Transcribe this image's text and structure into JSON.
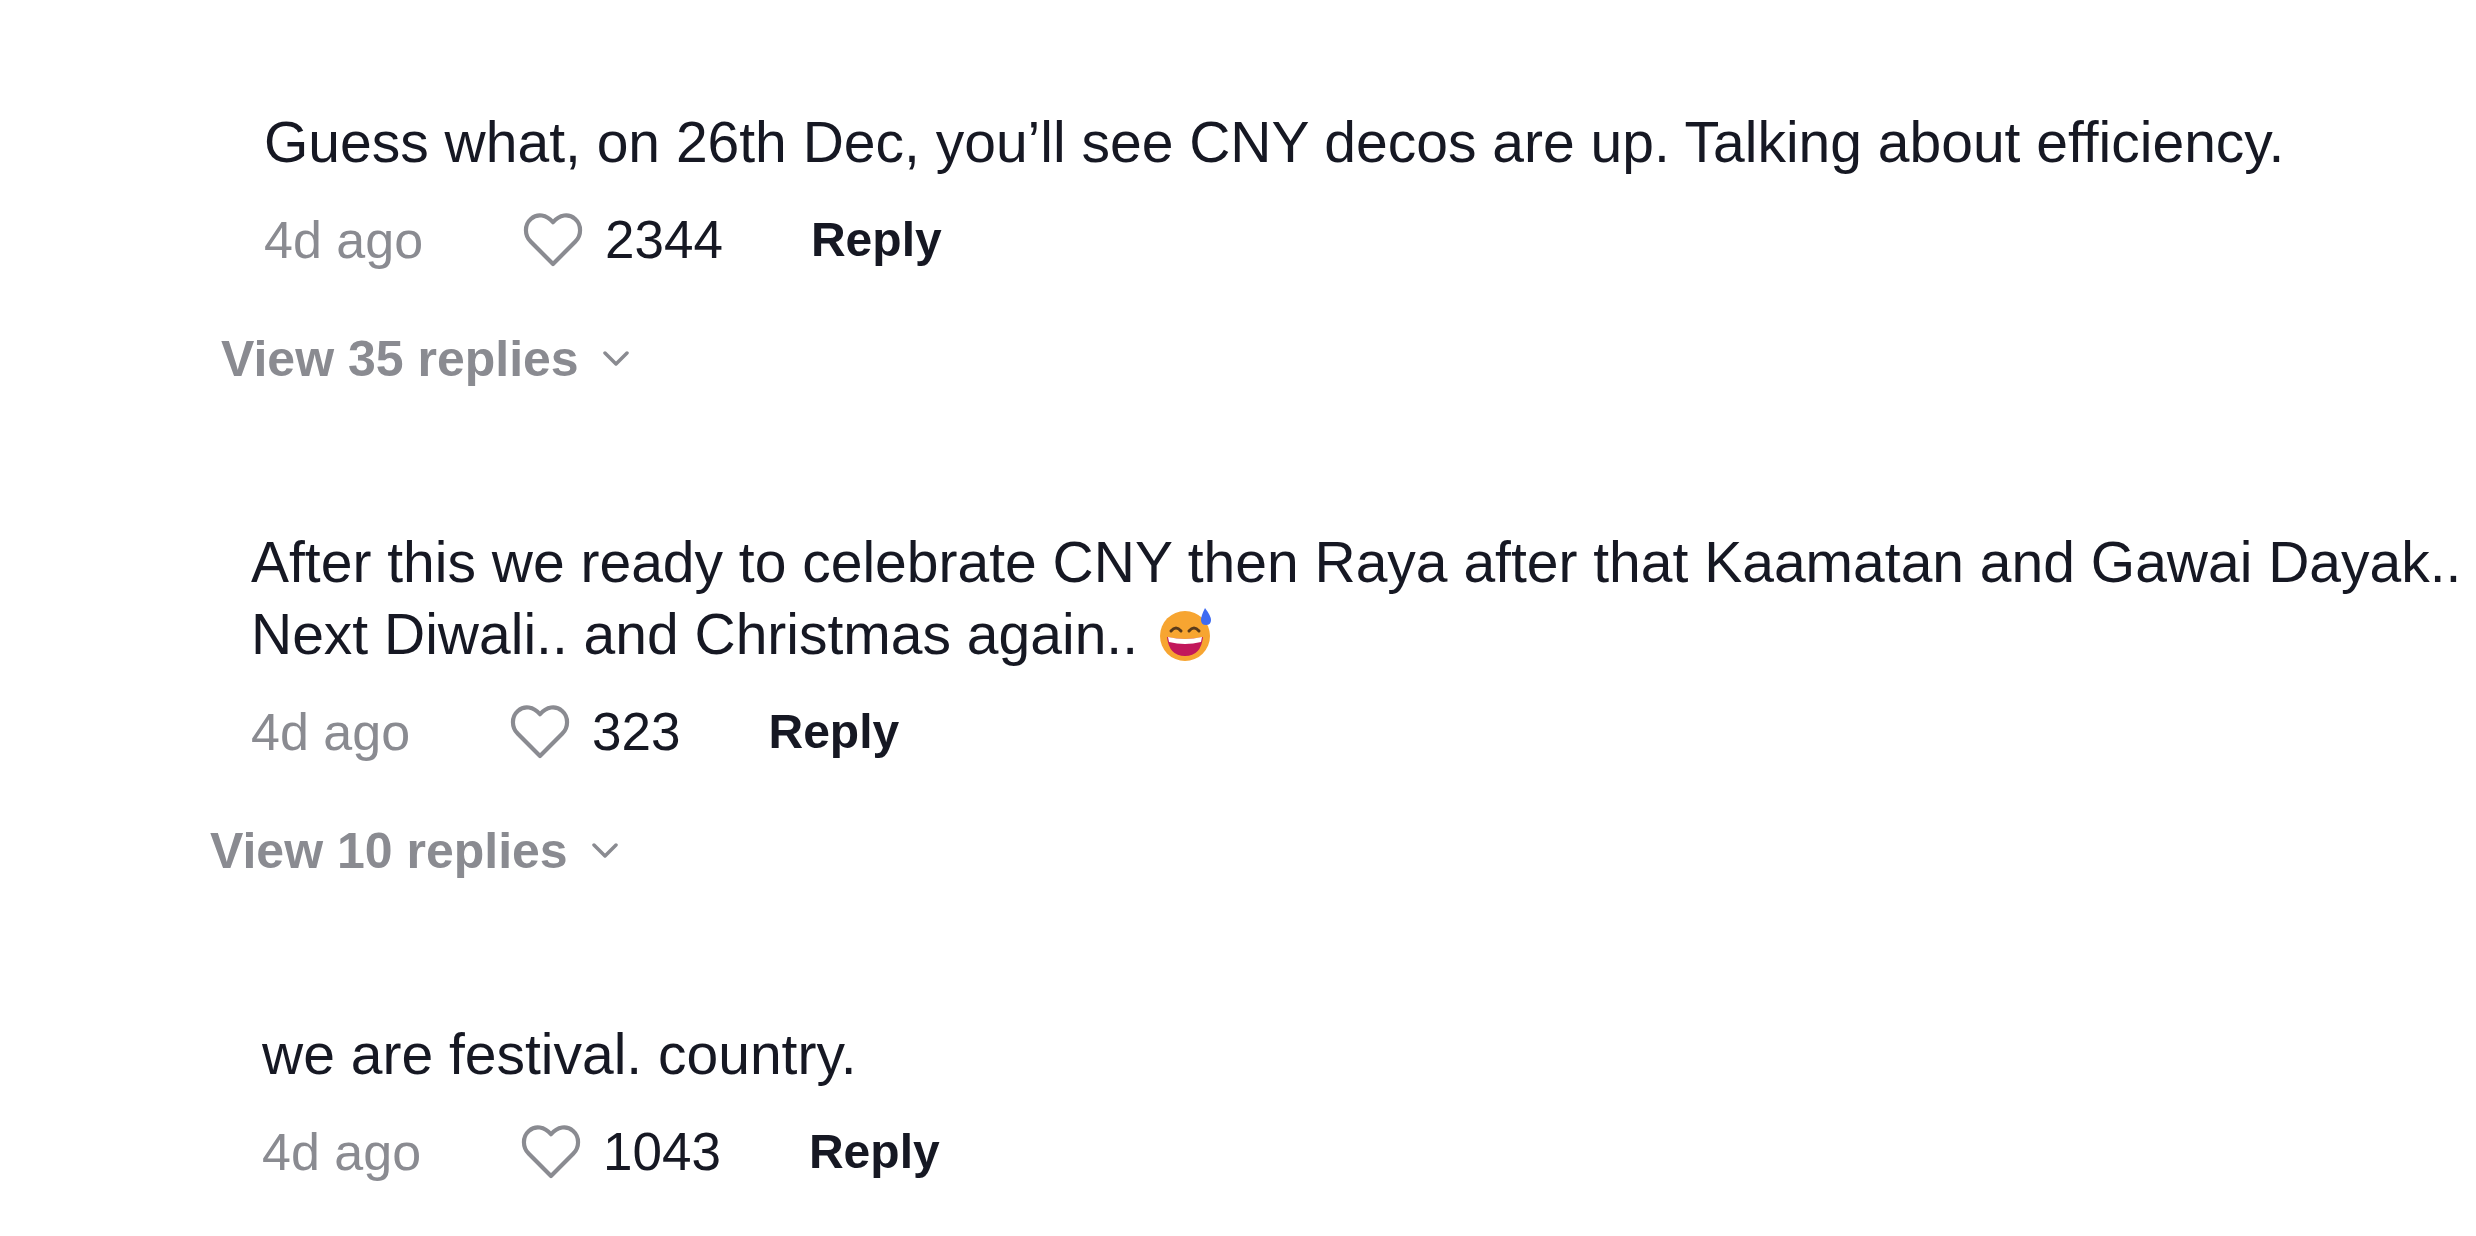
{
  "comments": [
    {
      "lines": [
        "Guess what, on 26th Dec, you’ll see CNY decos are up. Talking about efficiency."
      ],
      "trailing_emoji": false,
      "time": "4d ago",
      "liked": false,
      "likes": "2344",
      "reply": "Reply",
      "view_replies": "View 35 replies"
    },
    {
      "lines": [
        "After this we ready to celebrate CNY then Raya after that Kaamatan and Gawai Dayak..",
        "Next Diwali.. and Christmas again.."
      ],
      "trailing_emoji": true,
      "time": "4d ago",
      "liked": false,
      "likes": "323",
      "reply": "Reply",
      "view_replies": "View 10 replies"
    },
    {
      "lines": [
        "we are festival. country."
      ],
      "trailing_emoji": false,
      "time": "4d ago",
      "liked": false,
      "likes": "1043",
      "reply": "Reply"
    }
  ]
}
